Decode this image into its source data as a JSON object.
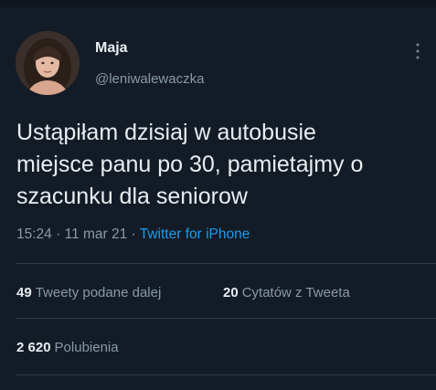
{
  "author": {
    "name": "Maja",
    "handle": "@leniwalewaczka"
  },
  "tweet": {
    "lines": [
      "Ustąpiłam dzisiaj w autobusie",
      "miejsce panu po 30, pamietajmy o",
      "szacunku dla seniorow"
    ],
    "time": "15:24",
    "separator": "·",
    "date": "11 mar 21",
    "source": "Twitter for iPhone"
  },
  "stats": {
    "retweets_count": "49",
    "retweets_label": "Tweety podane dalej",
    "quotes_count": "20",
    "quotes_label": "Cytatów z Tweeta",
    "likes_count": "2 620",
    "likes_label": "Polubienia"
  },
  "colors": {
    "background": "#131c26",
    "text_primary": "#e8edf1",
    "text_secondary": "#8899a6",
    "link": "#1d9bf0",
    "divider": "#2f3b47"
  },
  "icons": {
    "more": "more-vertical-icon",
    "avatar": "avatar"
  }
}
